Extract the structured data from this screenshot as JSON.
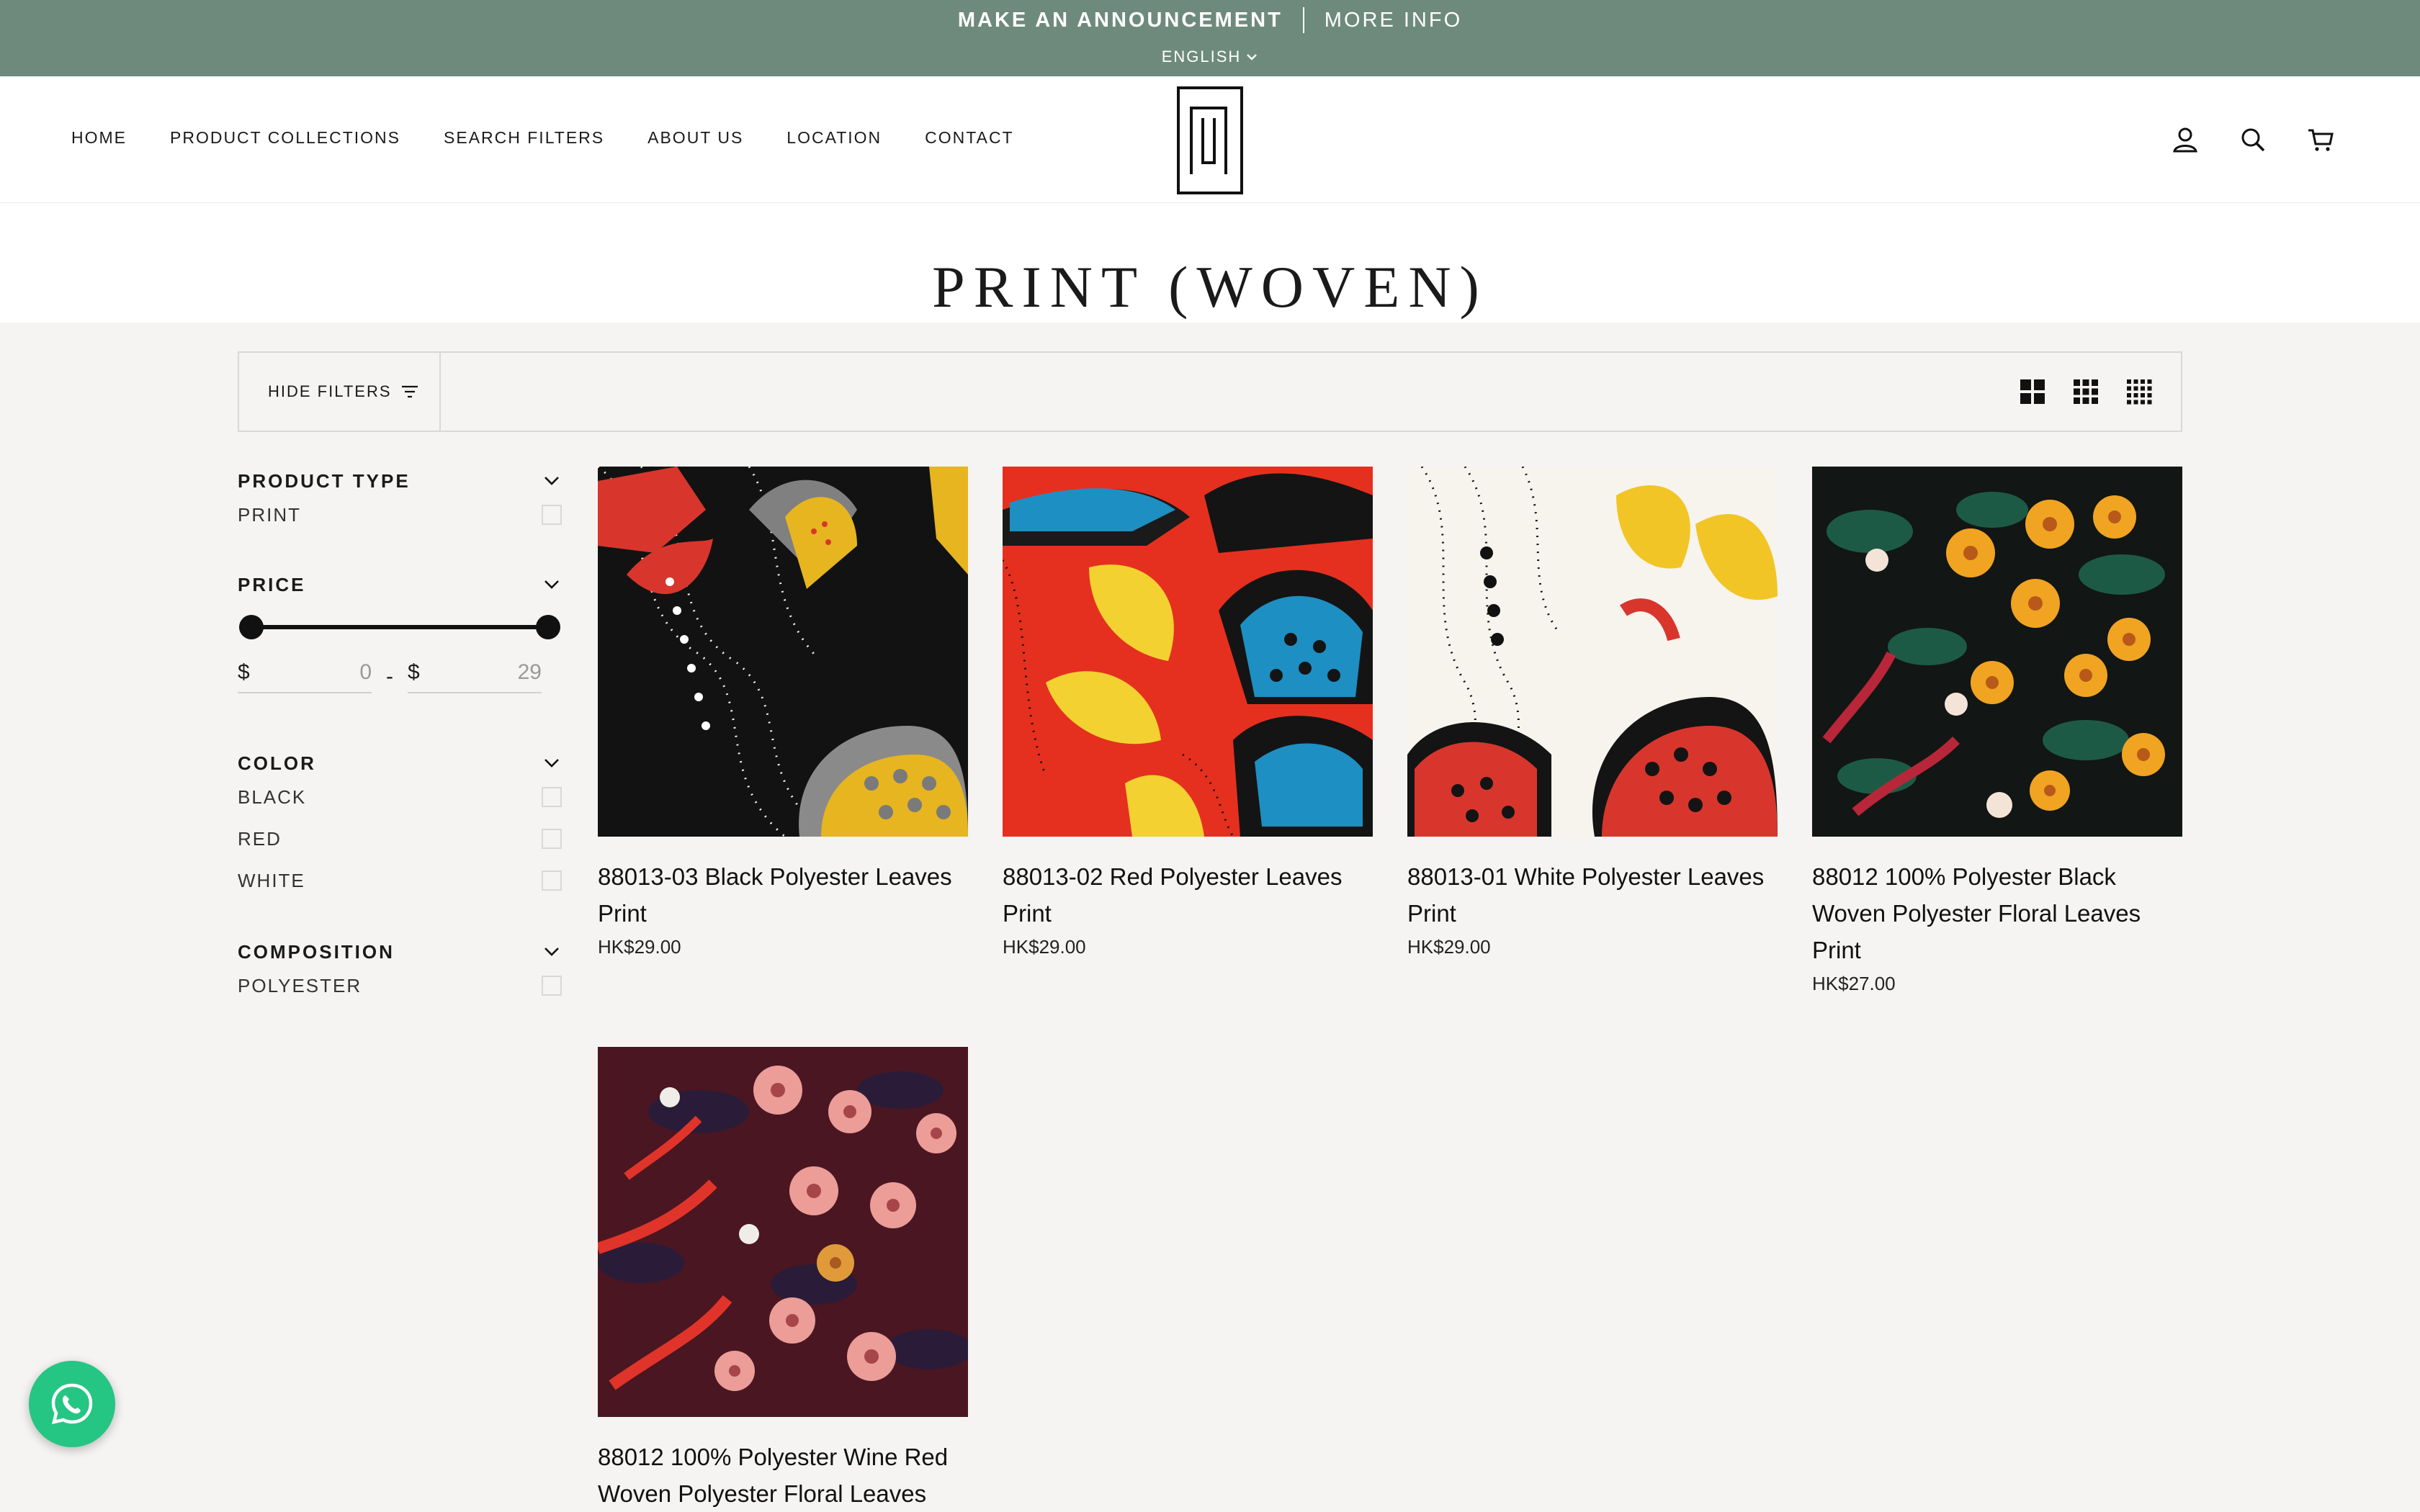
{
  "announcement": {
    "message": "MAKE AN ANNOUNCEMENT",
    "link": "MORE INFO",
    "language": "ENGLISH"
  },
  "nav": {
    "items": [
      "HOME",
      "PRODUCT COLLECTIONS",
      "SEARCH FILTERS",
      "ABOUT US",
      "LOCATION",
      "CONTACT"
    ]
  },
  "header_icons": [
    "account-icon",
    "search-icon",
    "cart-icon"
  ],
  "page": {
    "title": "PRINT (WOVEN)"
  },
  "toolbar": {
    "hide_filters": "HIDE FILTERS",
    "grid_options": [
      "grid-large-icon",
      "grid-medium-icon",
      "grid-small-icon"
    ]
  },
  "filters": {
    "product_type": {
      "title": "PRODUCT TYPE",
      "options": [
        "PRINT"
      ]
    },
    "price": {
      "title": "PRICE",
      "currency": "$",
      "dash": "-",
      "min": "0",
      "max": "29"
    },
    "color": {
      "title": "COLOR",
      "options": [
        "BLACK",
        "RED",
        "WHITE"
      ]
    },
    "composition": {
      "title": "COMPOSITION",
      "options": [
        "POLYESTER"
      ]
    }
  },
  "products": [
    {
      "name": "88013-03 Black Polyester Leaves Print",
      "price": "HK$29.00"
    },
    {
      "name": "88013-02 Red Polyester Leaves Print",
      "price": "HK$29.00"
    },
    {
      "name": "88013-01 White Polyester Leaves Print",
      "price": "HK$29.00"
    },
    {
      "name": "88012 100% Polyester Black Woven Polyester Floral Leaves Print",
      "price": "HK$27.00"
    },
    {
      "name": "88012 100% Polyester Wine Red Woven Polyester Floral Leaves",
      "price": ""
    }
  ],
  "colors": {
    "announcement_bg": "#6e8a7d",
    "whatsapp": "#25c583",
    "page_bg": "#f5f4f2"
  }
}
